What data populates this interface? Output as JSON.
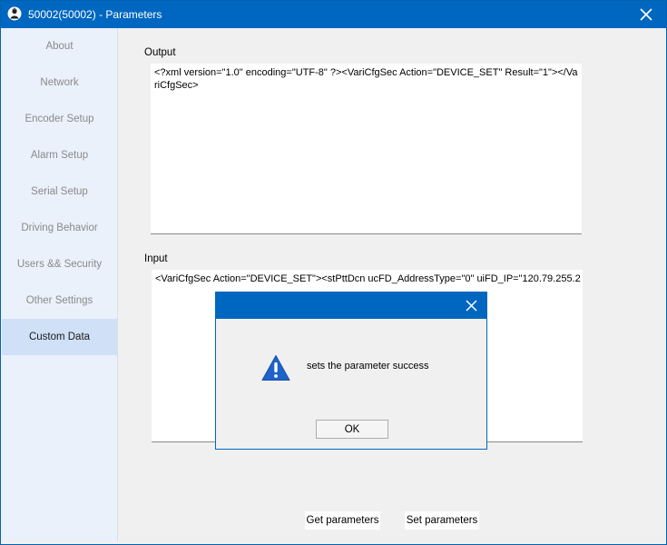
{
  "window": {
    "title": "50002(50002) - Parameters",
    "app_icon": "person-icon",
    "close_icon": "close-icon"
  },
  "sidebar": {
    "items": [
      {
        "label": "About",
        "active": false
      },
      {
        "label": "Network",
        "active": false
      },
      {
        "label": "Encoder Setup",
        "active": false
      },
      {
        "label": "Alarm Setup",
        "active": false
      },
      {
        "label": "Serial Setup",
        "active": false
      },
      {
        "label": "Driving Behavior",
        "active": false
      },
      {
        "label": "Users && Security",
        "active": false
      },
      {
        "label": "Other Settings",
        "active": false
      },
      {
        "label": "Custom Data",
        "active": true
      }
    ]
  },
  "main": {
    "output_label": "Output",
    "output_text": "<?xml version=\"1.0\" encoding=\"UTF-8\" ?><VariCfgSec Action=\"DEVICE_SET\" Result=\"1\"></VariCfgSec>",
    "input_label": "Input",
    "input_text": "<VariCfgSec Action=\"DEVICE_SET\"><stPttDcn ucFD_AddressType=\"0\" uiFD_IP=\"120.79.255.2",
    "get_button": "Get parameters",
    "set_button": "Set parameters"
  },
  "dialog": {
    "message": "sets the parameter success",
    "ok_label": "OK",
    "icon": "warning-icon",
    "close_icon": "close-icon"
  },
  "colors": {
    "titlebar": "#0067c0",
    "sidebar_bg": "#eaf1fb",
    "sidebar_active": "#cfe0f7",
    "warning": "#1e63c9"
  }
}
